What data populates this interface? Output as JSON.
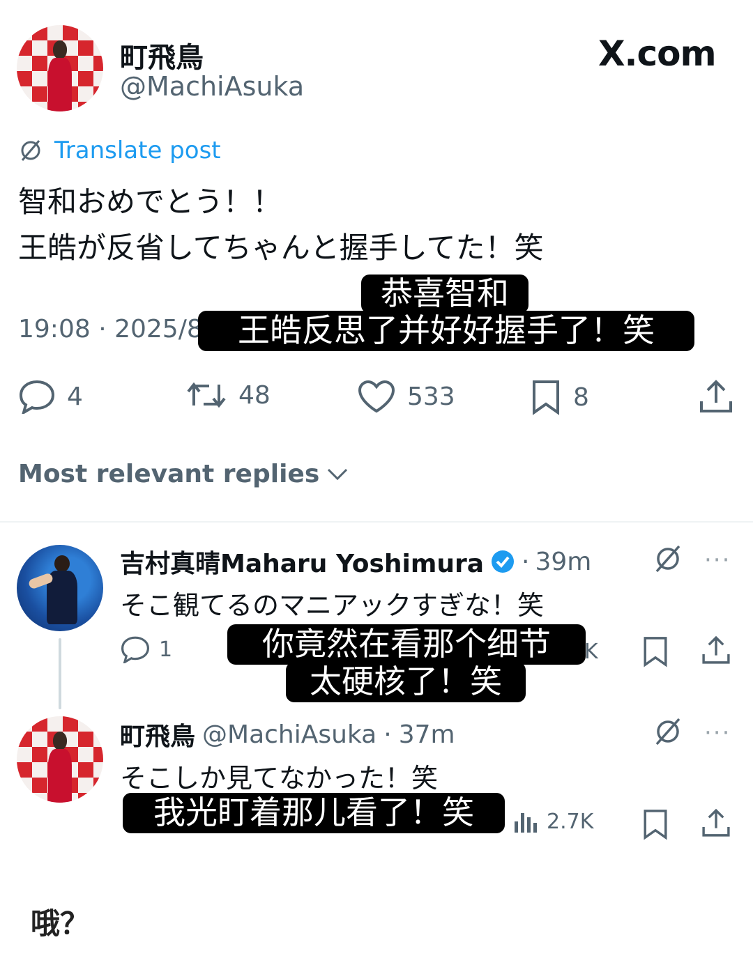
{
  "post": {
    "author_name": "町飛鳥",
    "author_handle": "@MachiAsuka",
    "brand": "X.com",
    "translate_label": "Translate post",
    "text_line1": "智和おめでとう！！",
    "text_line2": "王皓が反省してちゃんと握手してた！笑",
    "timestamp_partial": "19:08 · 2025/8",
    "caption_line1": "恭喜智和",
    "caption_line2": "王皓反思了并好好握手了！笑",
    "stats": {
      "replies": "4",
      "reposts": "48",
      "likes": "533",
      "bookmarks": "8"
    }
  },
  "replies_section": {
    "sort_label": "Most relevant replies"
  },
  "reply1": {
    "author_name": "吉村真晴Maharu Yoshimura",
    "time": "39m",
    "text": "そこ観てるのマニアックすぎな！笑",
    "replies": "1",
    "views_partial": "K",
    "caption_line1": "你竟然在看那个细节",
    "caption_line2": "太硬核了！笑"
  },
  "reply2": {
    "author_name": "町飛鳥",
    "author_handle": "@MachiAsuka",
    "time": "37m",
    "text": "そこしか見てなかった！笑",
    "views": "2.7K",
    "caption": "我光盯着那儿看了！笑"
  },
  "footer": {
    "comment": "哦？"
  },
  "colors": {
    "accent": "#1d9bf0",
    "text": "#0f1419",
    "muted": "#536471"
  },
  "icons": [
    "translate-icon",
    "reply-icon",
    "repost-icon",
    "like-icon",
    "bookmark-icon",
    "share-icon",
    "chevron-down-icon",
    "verified-icon",
    "grok-icon",
    "more-icon",
    "views-icon"
  ]
}
